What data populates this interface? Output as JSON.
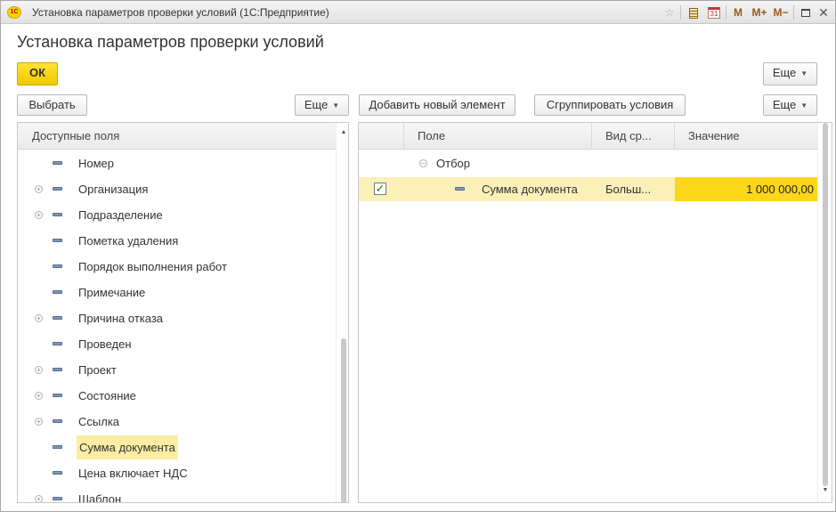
{
  "window": {
    "title": "Установка параметров проверки условий  (1С:Предприятие)",
    "app_icon_text": "1С",
    "toolbar": {
      "m": "M",
      "m_plus": "M+",
      "m_minus": "M−",
      "calendar_day": "31",
      "close": "✕"
    }
  },
  "form": {
    "title": "Установка параметров проверки условий",
    "ok_label": "ОК",
    "more_label": "Еще"
  },
  "left": {
    "choose_label": "Выбрать",
    "more_label": "Еще",
    "header": "Доступные поля",
    "items": [
      {
        "label": "Номер",
        "expandable": false,
        "selected": false
      },
      {
        "label": "Организация",
        "expandable": true,
        "selected": false
      },
      {
        "label": "Подразделение",
        "expandable": true,
        "selected": false
      },
      {
        "label": "Пометка удаления",
        "expandable": false,
        "selected": false
      },
      {
        "label": "Порядок выполнения работ",
        "expandable": false,
        "selected": false
      },
      {
        "label": "Примечание",
        "expandable": false,
        "selected": false
      },
      {
        "label": "Причина отказа",
        "expandable": true,
        "selected": false
      },
      {
        "label": "Проведен",
        "expandable": false,
        "selected": false
      },
      {
        "label": "Проект",
        "expandable": true,
        "selected": false
      },
      {
        "label": "Состояние",
        "expandable": true,
        "selected": false
      },
      {
        "label": "Ссылка",
        "expandable": true,
        "selected": false
      },
      {
        "label": "Сумма документа",
        "expandable": false,
        "selected": true
      },
      {
        "label": "Цена включает НДС",
        "expandable": false,
        "selected": false
      },
      {
        "label": "Шаблон",
        "expandable": true,
        "selected": false
      }
    ]
  },
  "right": {
    "add_label": "Добавить новый элемент",
    "group_label": "Сгруппировать условия",
    "more_label": "Еще",
    "columns": {
      "field": "Поле",
      "kind": "Вид ср...",
      "value": "Значение"
    },
    "group": {
      "label": "Отбор",
      "expanded": true
    },
    "rows": [
      {
        "checked": true,
        "field": "Сумма документа",
        "kind": "Больш...",
        "value": "1 000 000,00"
      }
    ]
  },
  "colors": {
    "accent_yellow": "#f2c800",
    "selection_light": "#fbf1b8",
    "value_highlight": "#fcd619",
    "check_green": "#1a8a1a"
  }
}
